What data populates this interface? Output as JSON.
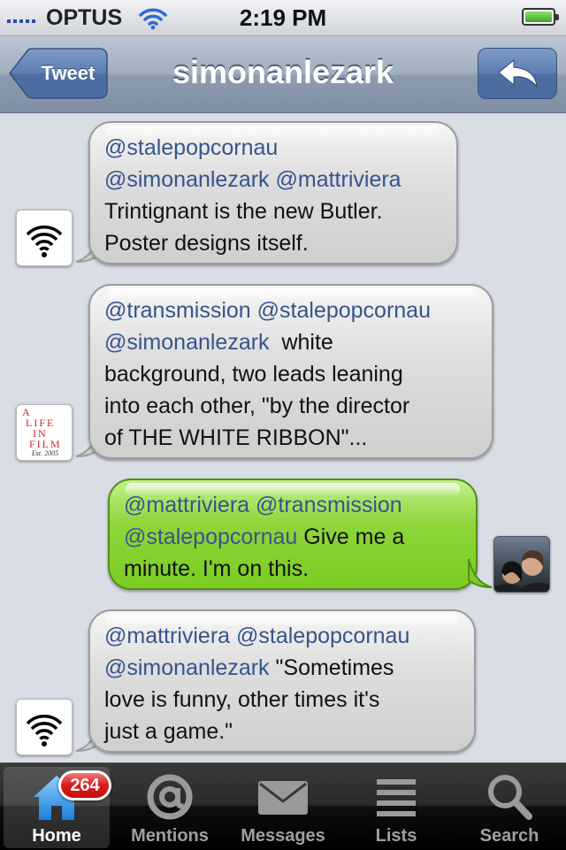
{
  "status_bar": {
    "carrier": "OPTUS",
    "time": "2:19 PM",
    "battery_level": 1.0
  },
  "nav": {
    "back_label": "Tweet",
    "title": "simonanlezark",
    "reply_icon": "reply-arrow-icon"
  },
  "messages": [
    {
      "side": "left",
      "avatar_icon": "wifi-icon",
      "mentions": [
        "@stalepopcornau",
        "@simonanlezark @mattriviera"
      ],
      "text": [
        "Trintignant is the new Butler.",
        "Poster designs itself."
      ]
    },
    {
      "side": "left",
      "avatar_label": [
        "A",
        "LIFE",
        "IN",
        "FILM"
      ],
      "avatar_est": "Est. 2005",
      "mentions": [
        "@transmission @stalepopcornau",
        "@simonanlezark"
      ],
      "line2_tail": "white",
      "text": [
        "background, two leads leaning",
        "into each other, \"by the director",
        "of THE WHITE RIBBON\"..."
      ]
    },
    {
      "side": "right",
      "avatar_icon": "user-photo-avatar",
      "mentions": [
        "@mattriviera @transmission",
        "@stalepopcornau"
      ],
      "line2_tail": "Give me a",
      "text": [
        "minute. I'm on this."
      ]
    },
    {
      "side": "left",
      "avatar_icon": "wifi-icon",
      "mentions": [
        "@mattriviera @stalepopcornau",
        "@simonanlezark"
      ],
      "line2_tail": "\"Sometimes",
      "text": [
        "love is funny, other times it's",
        "just a game.\""
      ]
    }
  ],
  "tabbar": {
    "tabs": [
      {
        "label": "Home",
        "icon": "home-icon",
        "badge": "264",
        "selected": true
      },
      {
        "label": "Mentions",
        "icon": "at-sign-icon"
      },
      {
        "label": "Messages",
        "icon": "envelope-icon"
      },
      {
        "label": "Lists",
        "icon": "list-icon"
      },
      {
        "label": "Search",
        "icon": "magnifier-icon"
      }
    ]
  }
}
